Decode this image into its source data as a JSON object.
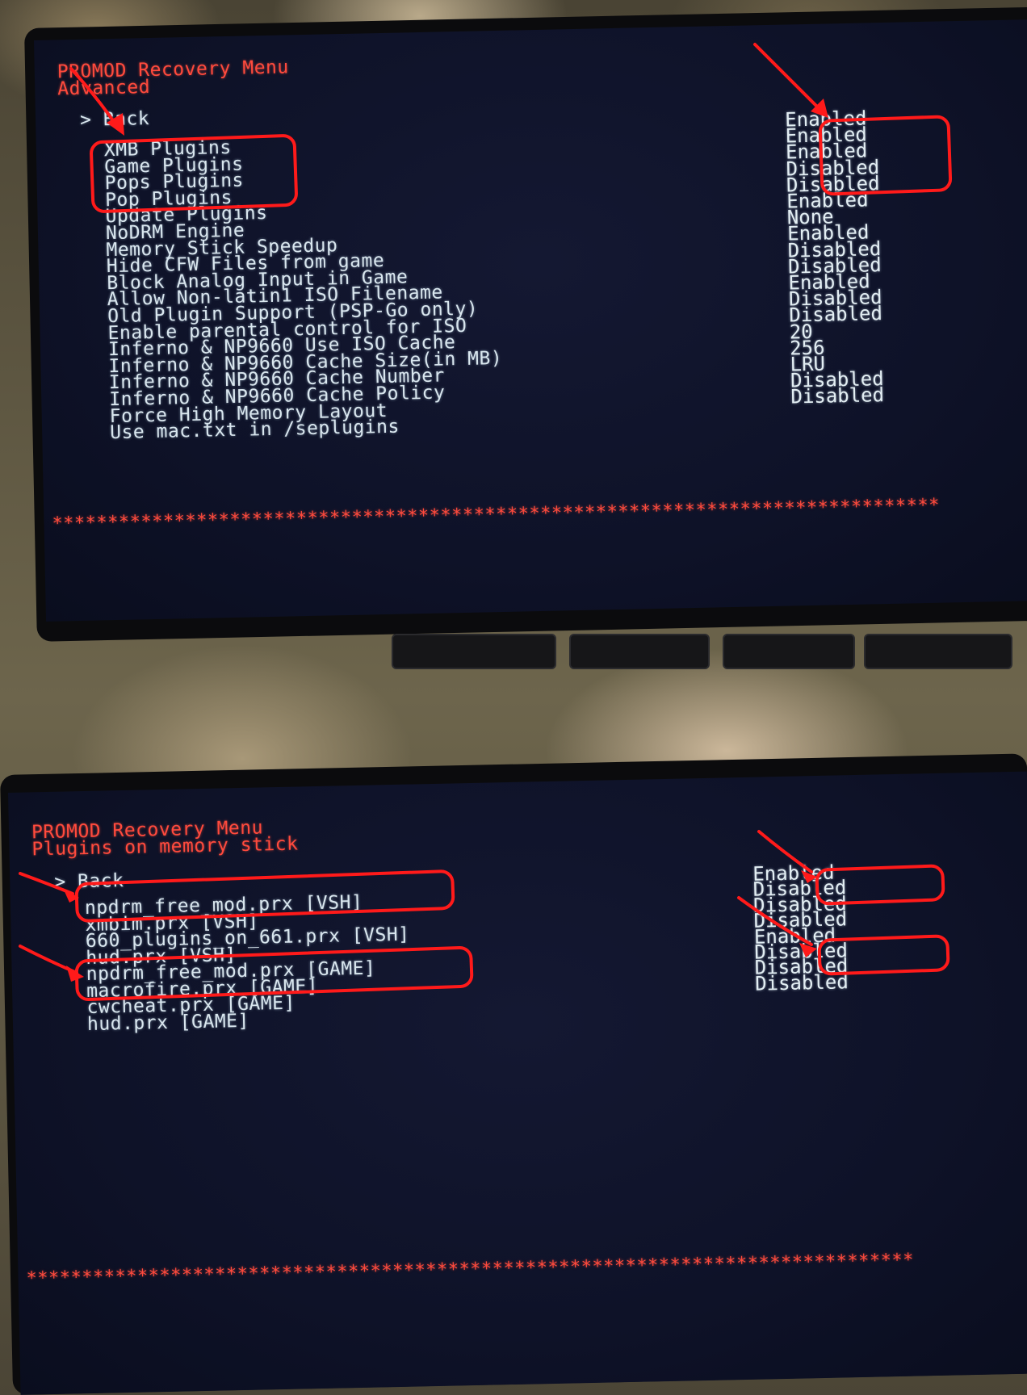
{
  "top": {
    "header_title": "PROMOD Recovery Menu",
    "header_sub": "Advanced",
    "back_label": "> Back",
    "items": [
      "XMB Plugins",
      "Game Plugins",
      "Pops Plugins",
      "Pop Plugins",
      "Update Plugins",
      "NoDRM Engine",
      "Memory Stick Speedup",
      "Hide CFW Files from game",
      "Block Analog Input in Game",
      "Allow Non-latin1 ISO Filename",
      "Old Plugin Support (PSP-Go only)",
      "Enable parental control for ISO",
      "Inferno & NP9660 Use ISO Cache",
      "Inferno & NP9660 Cache Size(in MB)",
      "Inferno & NP9660 Cache Number",
      "Inferno & NP9660 Cache Policy",
      "Force High Memory Layout",
      "Use mac.txt in /seplugins"
    ],
    "values": [
      "Enabled",
      "Enabled",
      "Enabled",
      "Disabled",
      "Disabled",
      "Enabled",
      "None",
      "Enabled",
      "Disabled",
      "Disabled",
      "Enabled",
      "Disabled",
      "Disabled",
      "20",
      "256",
      "LRU",
      "Disabled",
      "Disabled"
    ],
    "stars": "********************************************************************************"
  },
  "bottom": {
    "header_title": "PROMOD Recovery Menu",
    "header_sub": "Plugins on memory stick",
    "back_label": "> Back",
    "items": [
      "npdrm_free_mod.prx [VSH]",
      "xmbim.prx [VSH]",
      "660_plugins_on_661.prx [VSH]",
      "hud.prx [VSH]",
      "npdrm_free_mod.prx [GAME]",
      "macrofire.prx [GAME]",
      "cwcheat.prx [GAME]",
      "hud.prx [GAME]"
    ],
    "values": [
      "Enabled",
      "Disabled",
      "Disabled",
      "Disabled",
      "Enabled",
      "Disabled",
      "Disabled",
      "Disabled"
    ],
    "stars": "********************************************************************************"
  },
  "colors": {
    "header_red": "#ff4a3d",
    "text_white": "#d9e6ee",
    "annotation_red": "#ff1a1a",
    "screen_bg": "#0e1228"
  }
}
